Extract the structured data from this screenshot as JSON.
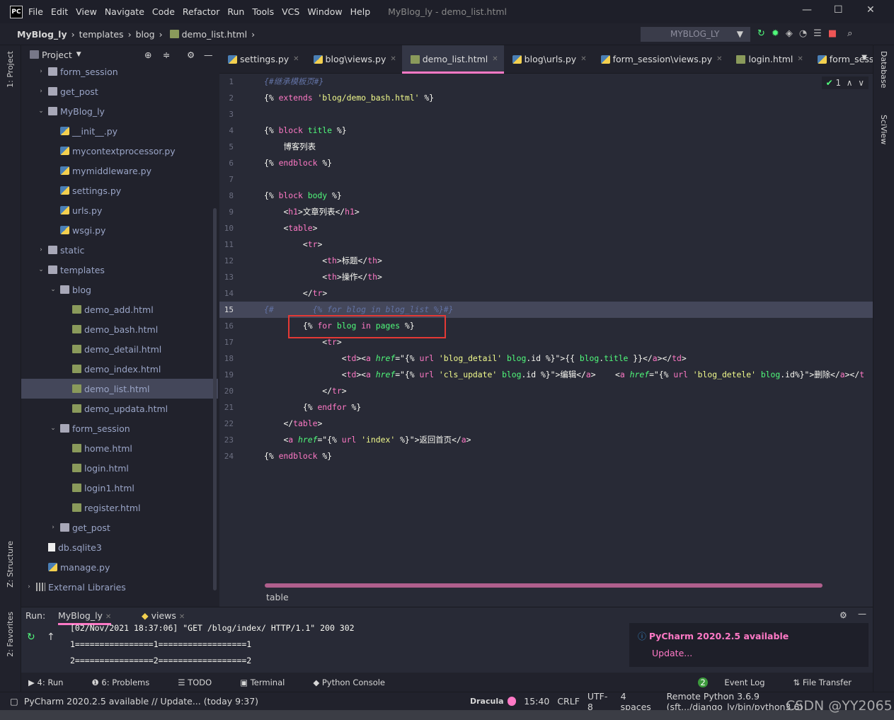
{
  "titlebar": {
    "logo": "PC",
    "menu": [
      "File",
      "Edit",
      "View",
      "Navigate",
      "Code",
      "Refactor",
      "Run",
      "Tools",
      "VCS",
      "Window",
      "Help"
    ],
    "title": "MyBlog_ly - demo_list.html"
  },
  "navbar": {
    "breadcrumbs": [
      "MyBlog_ly",
      "templates",
      "blog",
      "demo_list.html"
    ],
    "run_config": "MYBLOG_LY"
  },
  "left_stripe": {
    "project": "1: Project",
    "structure": "Z: Structure",
    "favorites": "2: Favorites"
  },
  "right_stripe": {
    "database": "Database",
    "sciview": "SciView"
  },
  "project": {
    "title": "Project",
    "items": [
      {
        "d": 1,
        "type": "folder",
        "state": "collapsed",
        "label": "form_session"
      },
      {
        "d": 1,
        "type": "folder",
        "state": "collapsed",
        "label": "get_post"
      },
      {
        "d": 1,
        "type": "folder",
        "state": "expanded",
        "label": "MyBlog_ly"
      },
      {
        "d": 2,
        "type": "py",
        "label": "__init__.py"
      },
      {
        "d": 2,
        "type": "py",
        "label": "mycontextprocessor.py"
      },
      {
        "d": 2,
        "type": "py",
        "label": "mymiddleware.py"
      },
      {
        "d": 2,
        "type": "py",
        "label": "settings.py"
      },
      {
        "d": 2,
        "type": "py",
        "label": "urls.py"
      },
      {
        "d": 2,
        "type": "py",
        "label": "wsgi.py"
      },
      {
        "d": 1,
        "type": "folder",
        "state": "collapsed",
        "label": "static"
      },
      {
        "d": 1,
        "type": "folder",
        "state": "expanded",
        "label": "templates"
      },
      {
        "d": 2,
        "type": "folder",
        "state": "expanded",
        "label": "blog"
      },
      {
        "d": 3,
        "type": "html",
        "label": "demo_add.html"
      },
      {
        "d": 3,
        "type": "html",
        "label": "demo_bash.html"
      },
      {
        "d": 3,
        "type": "html",
        "label": "demo_detail.html"
      },
      {
        "d": 3,
        "type": "html",
        "label": "demo_index.html"
      },
      {
        "d": 3,
        "type": "html",
        "label": "demo_list.html",
        "selected": true
      },
      {
        "d": 3,
        "type": "html",
        "label": "demo_updata.html"
      },
      {
        "d": 2,
        "type": "folder",
        "state": "expanded",
        "label": "form_session"
      },
      {
        "d": 3,
        "type": "html",
        "label": "home.html"
      },
      {
        "d": 3,
        "type": "html",
        "label": "login.html"
      },
      {
        "d": 3,
        "type": "html",
        "label": "login1.html"
      },
      {
        "d": 3,
        "type": "html",
        "label": "register.html"
      },
      {
        "d": 2,
        "type": "folder",
        "state": "collapsed",
        "label": "get_post"
      },
      {
        "d": 1,
        "type": "file",
        "label": "db.sqlite3"
      },
      {
        "d": 1,
        "type": "py",
        "label": "manage.py"
      },
      {
        "d": 0,
        "type": "lib",
        "state": "collapsed",
        "label": "External Libraries"
      }
    ]
  },
  "editor": {
    "tabs": [
      {
        "label": "settings.py",
        "icon": "py"
      },
      {
        "label": "blog\\views.py",
        "icon": "py"
      },
      {
        "label": "demo_list.html",
        "icon": "html",
        "active": true
      },
      {
        "label": "blog\\urls.py",
        "icon": "py"
      },
      {
        "label": "form_session\\views.py",
        "icon": "py"
      },
      {
        "label": "login.html",
        "icon": "html"
      },
      {
        "label": "form_session\\u",
        "icon": "py"
      }
    ],
    "inspection_count": "1",
    "current_line": 15,
    "lines": [
      "{#继承模板页#}",
      "{% extends 'blog/demo_bash.html' %}",
      "",
      "{% block title %}",
      "    博客列表",
      "{% endblock %}",
      "",
      "{% block body %}",
      "    <h1>文章列表</h1>",
      "    <table>",
      "        <tr>",
      "            <th>标题</th>",
      "            <th>操作</th>",
      "        </tr>",
      "{#        {% for blog in blog_list %}#}",
      "        {% for blog in pages %}",
      "            <tr>",
      "                <td><a href=\"{% url 'blog_detail' blog.id %}\">{{ blog.title }}</a></td>",
      "                <td><a href=\"{% url 'cls_update' blog.id %}\">编辑</a>    <a href=\"{% url 'blog_detele' blog.id%}\">删除</a></t",
      "            </tr>",
      "        {% endfor %}",
      "    </table>",
      "    <a href=\"{% url 'index' %}\">返回首页</a>",
      "{% endblock %}"
    ],
    "breadcrumb": "table"
  },
  "run": {
    "label": "Run:",
    "tabs": [
      "MyBlog_ly",
      "views"
    ],
    "console": [
      "[02/Nov/2021 18:37:06] \"GET /blog/index/ HTTP/1.1\" 200 302",
      "1================1==================1",
      "2================2==================2"
    ]
  },
  "notification": {
    "title": "PyCharm 2020.2.5 available",
    "link": "Update..."
  },
  "tool_tabs": {
    "left": [
      "4: Run",
      "6: Problems",
      "TODO",
      "Terminal",
      "Python Console"
    ],
    "right": [
      "Event Log",
      "File Transfer"
    ],
    "event_count": "2"
  },
  "status": {
    "message": "PyCharm 2020.2.5 available // Update... (today 9:37)",
    "theme": "Dracula",
    "position": "15:40",
    "line_sep": "CRLF",
    "encoding": "UTF-8",
    "indent": "4 spaces",
    "interpreter": "Remote Python 3.6.9 (sft.../django_ly/bin/python3.6)"
  },
  "watermark": "CSDN @YY2065",
  "colors": {
    "accent": "#ff79c6",
    "editor_bg": "#282a36",
    "keyword": "#ff79c6",
    "string": "#f1fa8c",
    "name": "#50fa7b",
    "comment": "#6272a4",
    "highlight_box": "#e53935"
  }
}
